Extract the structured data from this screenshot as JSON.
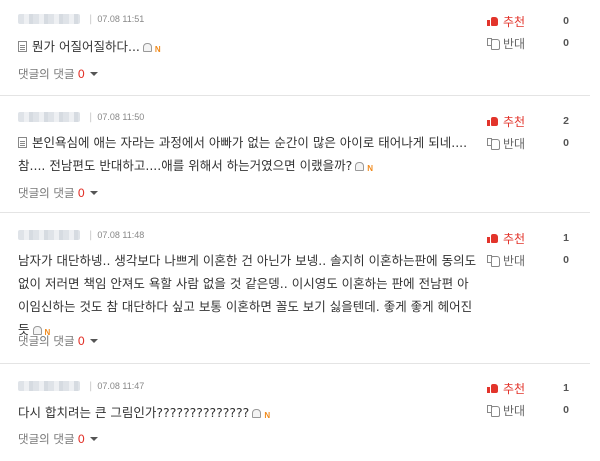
{
  "comments": [
    {
      "date": "07.08 11:51",
      "lines": [
        "뭔가 어질어질하다..."
      ],
      "reply_label": "댓글의 댓글",
      "reply_count": "0",
      "up_label": "추천",
      "up_count": "0",
      "down_label": "반대",
      "down_count": "0"
    },
    {
      "date": "07.08 11:50",
      "lines": [
        "본인욕심에 애는 자라는 과정에서 아빠가 없는 순간이 많은 아이로 태어나게 되네....",
        "참.... 전남편도 반대하고....애를 위해서 하는거였으면 이랬을까?"
      ],
      "reply_label": "댓글의 댓글",
      "reply_count": "0",
      "up_label": "추천",
      "up_count": "2",
      "down_label": "반대",
      "down_count": "0"
    },
    {
      "date": "07.08 11:48",
      "lines": [
        "남자가 대단하넹.. 생각보다 나쁘게 이혼한 건 아닌가 보넹.. 솔지히 이혼하는판에 동의도",
        "없이 저러면 책임 안져도 욕할 사람 없을 것 같은뎅.. 이시영도 이혼하는 판에 전남편 아",
        "이임신하는 것도 참 대단하다 싶고 보통 이혼하면 꼴도 보기 싫을텐데. 좋게 좋게 헤어진",
        "듯"
      ],
      "reply_label": "댓글의 댓글",
      "reply_count": "0",
      "up_label": "추천",
      "up_count": "1",
      "down_label": "반대",
      "down_count": "0"
    },
    {
      "date": "07.08 11:47",
      "lines": [
        "다시 합치려는 큰 그림인가??????????????"
      ],
      "reply_label": "댓글의 댓글",
      "reply_count": "0",
      "up_label": "추천",
      "up_count": "1",
      "down_label": "반대",
      "down_count": "0"
    }
  ],
  "icons": {
    "document": "document-icon",
    "report": "report-icon",
    "new_badge": "N",
    "thumbs_up": "thumbs-up-icon",
    "thumbs_down": "thumbs-down-icon",
    "caret": "caret-down-icon"
  },
  "colors": {
    "accent_red": "#e2342b",
    "new_badge": "#f08a1c"
  }
}
